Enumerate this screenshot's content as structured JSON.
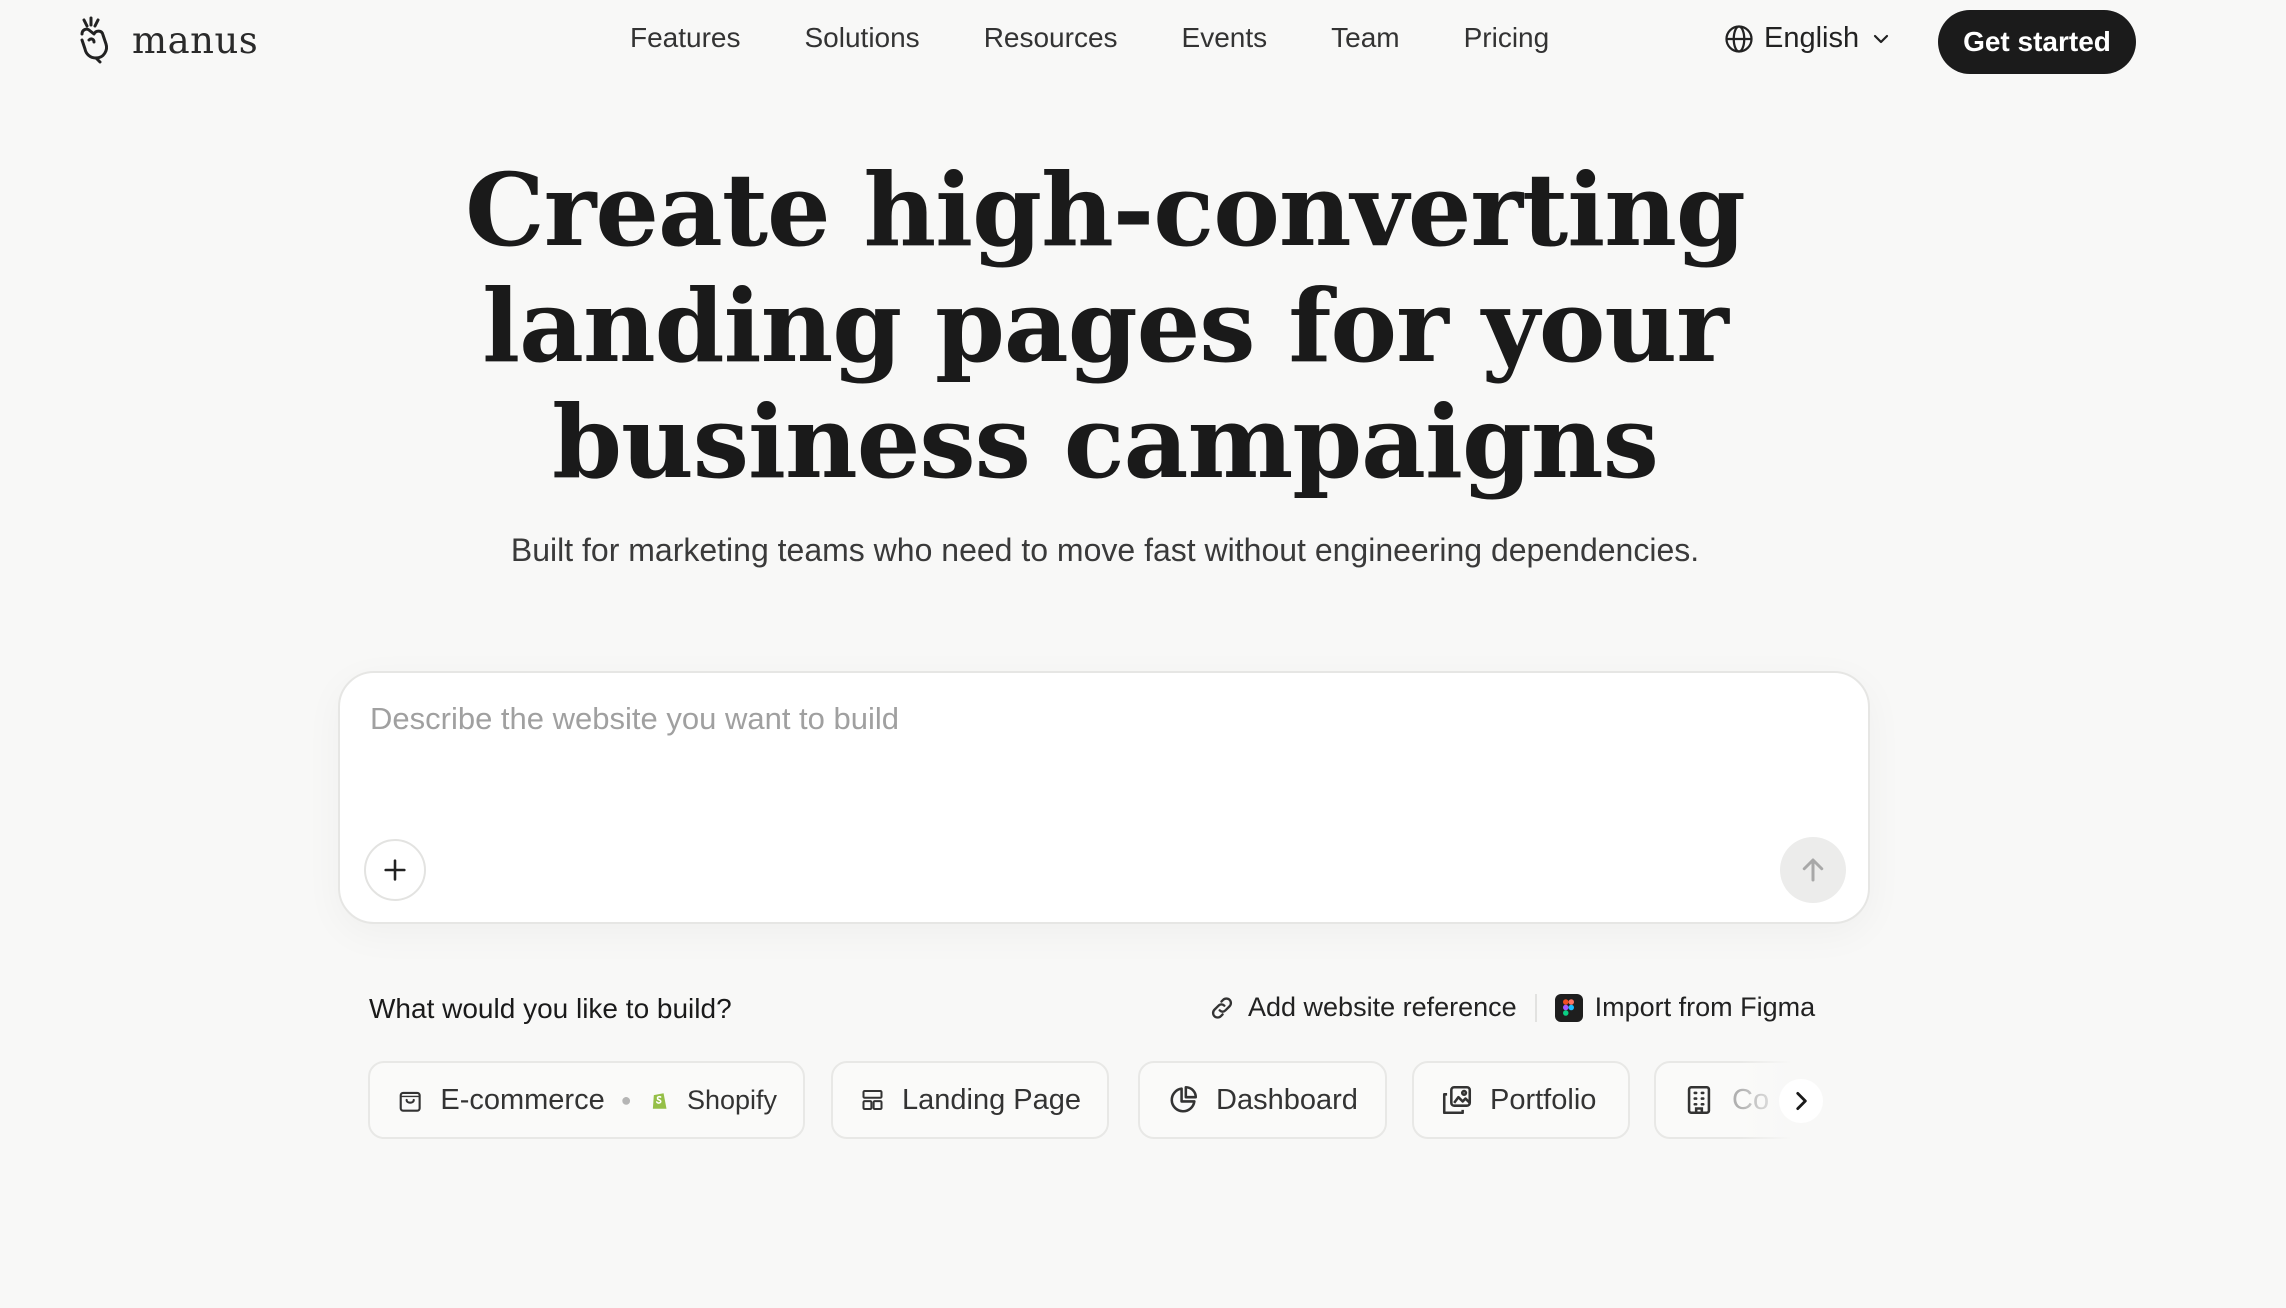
{
  "brand": {
    "name": "manus",
    "logo_icon": "manus-hand-icon"
  },
  "nav": {
    "items": [
      {
        "label": "Features"
      },
      {
        "label": "Solutions"
      },
      {
        "label": "Resources"
      },
      {
        "label": "Events"
      },
      {
        "label": "Team"
      },
      {
        "label": "Pricing"
      }
    ],
    "language": "English",
    "cta": "Get started"
  },
  "hero": {
    "title_lines": [
      "Create high-converting",
      "landing pages for your",
      "business campaigns"
    ],
    "subtitle": "Built for marketing teams who need to move fast without engineering dependencies."
  },
  "prompt": {
    "placeholder": "Describe the website you want to build",
    "value": ""
  },
  "build": {
    "question": "What would you like to build?",
    "add_reference": "Add website reference",
    "import_figma": "Import from Figma",
    "chips": [
      {
        "label": "E-commerce",
        "extra": "Shopify",
        "icon": "shopping-bag-icon"
      },
      {
        "label": "Landing Page",
        "icon": "layout-icon"
      },
      {
        "label": "Dashboard",
        "icon": "pie-chart-icon"
      },
      {
        "label": "Portfolio",
        "icon": "images-icon"
      },
      {
        "label": "Co",
        "icon": "building-icon"
      }
    ]
  },
  "colors": {
    "background": "#f8f8f7",
    "cta_bg": "#1b1b1b",
    "shopify": "#95bf47"
  }
}
